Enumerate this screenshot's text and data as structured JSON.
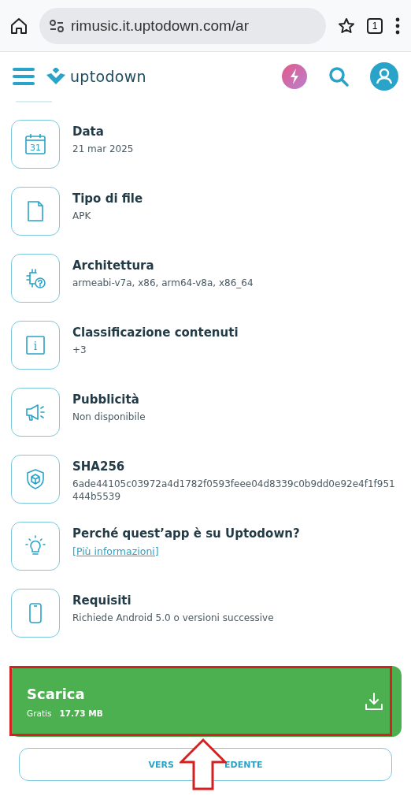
{
  "browser": {
    "url": "rimusic.it.uptodown.com/ar",
    "tab_count": "1"
  },
  "header": {
    "logo": "uptodown"
  },
  "details": [
    {
      "title": "Data",
      "kind": "text",
      "value": "21 mar 2025",
      "icon_text": "31"
    },
    {
      "title": "Tipo di file",
      "kind": "text",
      "value": "APK"
    },
    {
      "title": "Architettura",
      "kind": "text",
      "value": "armeabi-v7a, x86, arm64-v8a, x86_64"
    },
    {
      "title": "Classificazione contenuti",
      "kind": "text",
      "value": "+3",
      "icon_text": "i"
    },
    {
      "title": "Pubblicità",
      "kind": "text",
      "value": "Non disponibile"
    },
    {
      "title": "SHA256",
      "kind": "text",
      "value": "6ade44105c03972a4d1782f0593feee04d8339c0b9dd0e92e4f1f951 444b5539"
    },
    {
      "title": "Perché quest’app è su Uptodown?",
      "kind": "link",
      "value": "[Più informazioni]"
    },
    {
      "title": "Requisiti",
      "kind": "text",
      "value": "Richiede Android 5.0 o versioni successive"
    }
  ],
  "download": {
    "title": "Scarica",
    "price": "Gratis",
    "size": "17.73 MB",
    "highlighted": true
  },
  "previous_version": {
    "visible_parts": [
      "VERS",
      "EDENTE"
    ]
  }
}
